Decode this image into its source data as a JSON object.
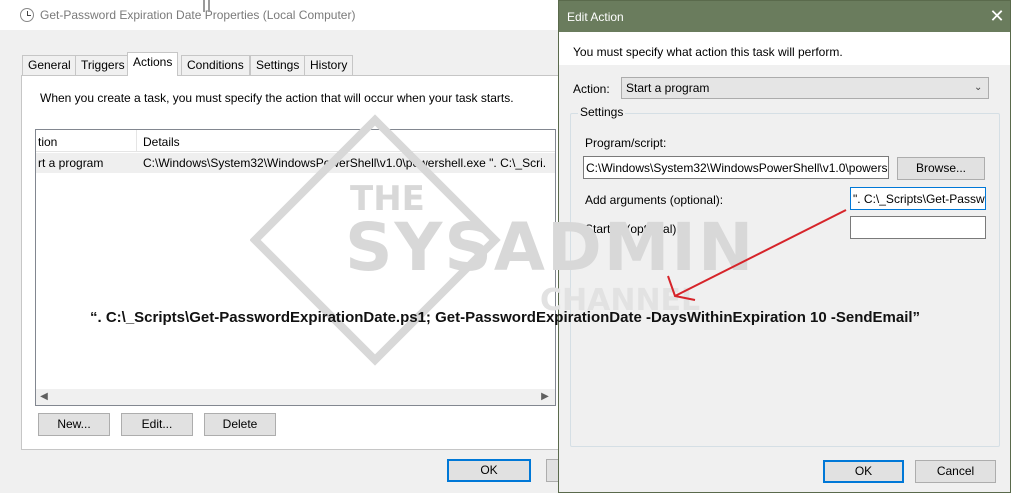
{
  "properties_window": {
    "title": "Get-Password Expiration Date Properties (Local Computer)",
    "tabs": [
      {
        "label": "General"
      },
      {
        "label": "Triggers"
      },
      {
        "label": "Actions"
      },
      {
        "label": "Conditions"
      },
      {
        "label": "Settings"
      },
      {
        "label": "History"
      }
    ],
    "active_tab": "Actions",
    "description": "When you create a task, you must specify the action that will occur when your task starts.",
    "list": {
      "columns": [
        "tion",
        "Details"
      ],
      "rows": [
        {
          "action": "rt a program",
          "details": "C:\\Windows\\System32\\WindowsPowerShell\\v1.0\\powershell.exe \". C:\\_Scri..."
        }
      ]
    },
    "buttons": {
      "new": "New...",
      "edit": "Edit...",
      "delete": "Delete",
      "ok": "OK"
    }
  },
  "edit_action": {
    "title": "Edit Action",
    "close_glyph": "✕",
    "instruction": "You must specify what action this task will perform.",
    "action_label": "Action:",
    "action_value": "Start a program",
    "settings_label": "Settings",
    "program_label": "Program/script:",
    "program_value": "C:\\Windows\\System32\\WindowsPowerShell\\v1.0\\powers",
    "browse_label": "Browse...",
    "args_label": "Add arguments (optional):",
    "args_value": "\". C:\\_Scripts\\Get-Passwo",
    "startin_label": "Start in (optional):",
    "startin_value": "",
    "ok_label": "OK",
    "cancel_label": "Cancel"
  },
  "annotation": {
    "text": "“. C:\\_Scripts\\Get-PasswordExpirationDate.ps1; Get-PasswordExpirationDate -DaysWithinExpiration 10 -SendEmail”",
    "arrow_color": "#d6242a"
  },
  "watermark": {
    "line1": "THE",
    "line2": "SYSADMIN",
    "line3": "CHANNEL",
    "color": "#d8d8d8"
  },
  "icons": {
    "task_icon": "clock-icon",
    "dropdown": "chevron-down-icon",
    "close": "close-icon",
    "scroll_left": "arrow-left-icon",
    "scroll_right": "arrow-right-icon"
  }
}
